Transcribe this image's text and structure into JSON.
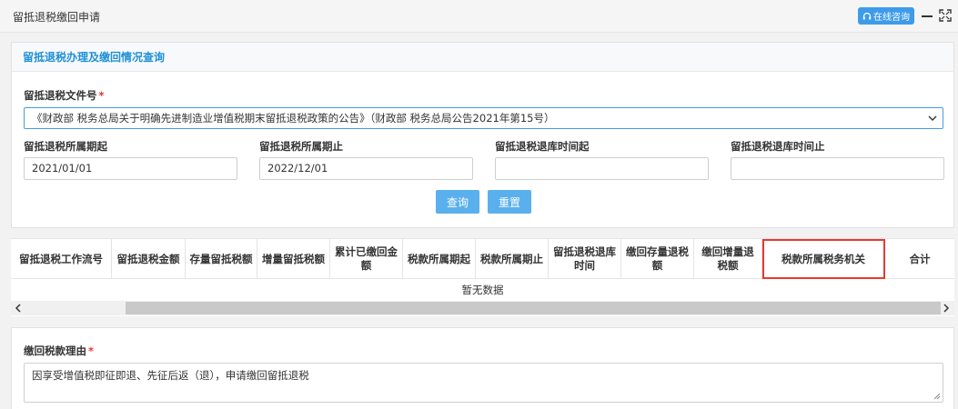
{
  "window": {
    "title": "留抵退税缴回申请",
    "consult_label": "在线咨询"
  },
  "query_panel": {
    "heading": "留抵退税办理及缴回情况查询",
    "doc_label": "留抵退税文件号",
    "doc_value": "《财政部 税务总局关于明确先进制造业增值税期末留抵退税政策的公告》（财政部 税务总局公告2021年第15号）",
    "fields": [
      {
        "label": "留抵退税所属期起",
        "value": "2021/01/01"
      },
      {
        "label": "留抵退税所属期止",
        "value": "2022/12/01"
      },
      {
        "label": "留抵退税退库时间起",
        "value": ""
      },
      {
        "label": "留抵退税退库时间止",
        "value": ""
      }
    ],
    "query_button": "查询",
    "reset_button": "重置"
  },
  "table": {
    "columns": [
      "留抵退税工作流号",
      "留抵退税金额",
      "存量留抵税额",
      "增量留抵税额",
      "累计已缴回金额",
      "税款所属期起",
      "税款所属期止",
      "留抵退税退库时间",
      "缴回存量退税额",
      "缴回增量退税额",
      "税款所属税务机关",
      "合计"
    ],
    "empty_text": "暂无数据"
  },
  "reason_panel": {
    "label": "缴回税款理由",
    "value": "因享受增值税即征即退、先征后返（退），申请缴回留抵退税"
  }
}
